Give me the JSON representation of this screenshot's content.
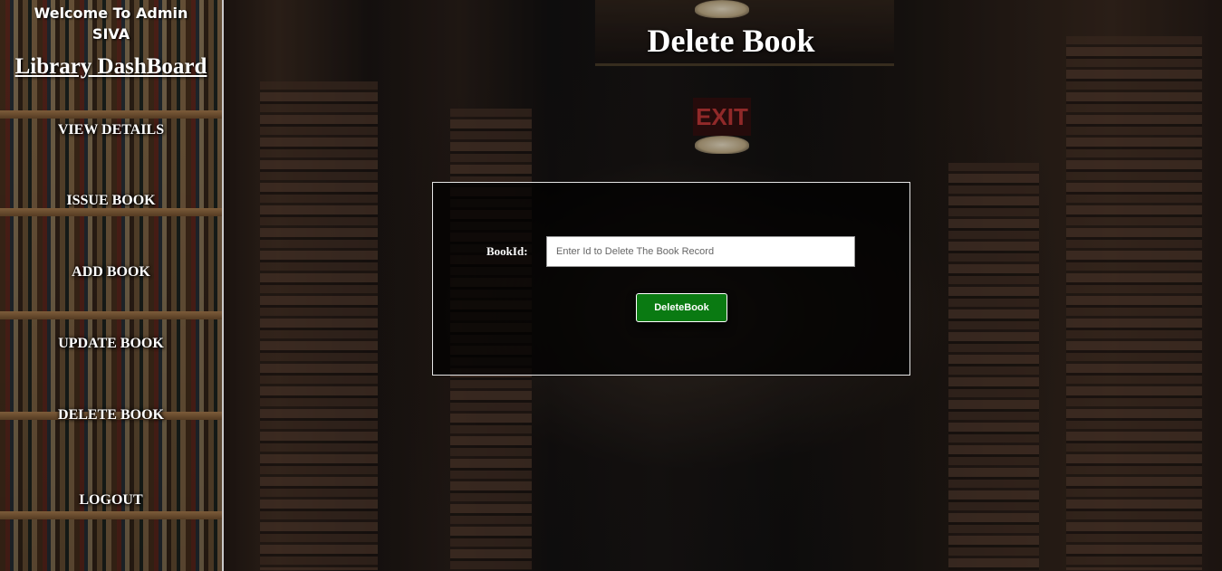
{
  "sidebar": {
    "welcome_line1": "Welcome To Admin",
    "welcome_line2": "SIVA",
    "dashboard_title": "Library DashBoard",
    "nav": {
      "view_details": "VIEW DETAILS",
      "issue_book": "ISSUE BOOK",
      "add_book": "ADD BOOK",
      "update_book": "UPDATE BOOK",
      "delete_book": "DELETE BOOK",
      "logout": "LOGOUT"
    }
  },
  "main": {
    "title": "Delete Book",
    "form": {
      "label": "BookId:",
      "input_value": "",
      "input_placeholder": "Enter Id to Delete The Book Record",
      "submit_label": "DeleteBook"
    },
    "background": {
      "exit_sign": "EXIT"
    }
  },
  "colors": {
    "submit_button": "#0a7a12",
    "text": "#ffffff",
    "sidebar_border": "#c8c8c8"
  }
}
